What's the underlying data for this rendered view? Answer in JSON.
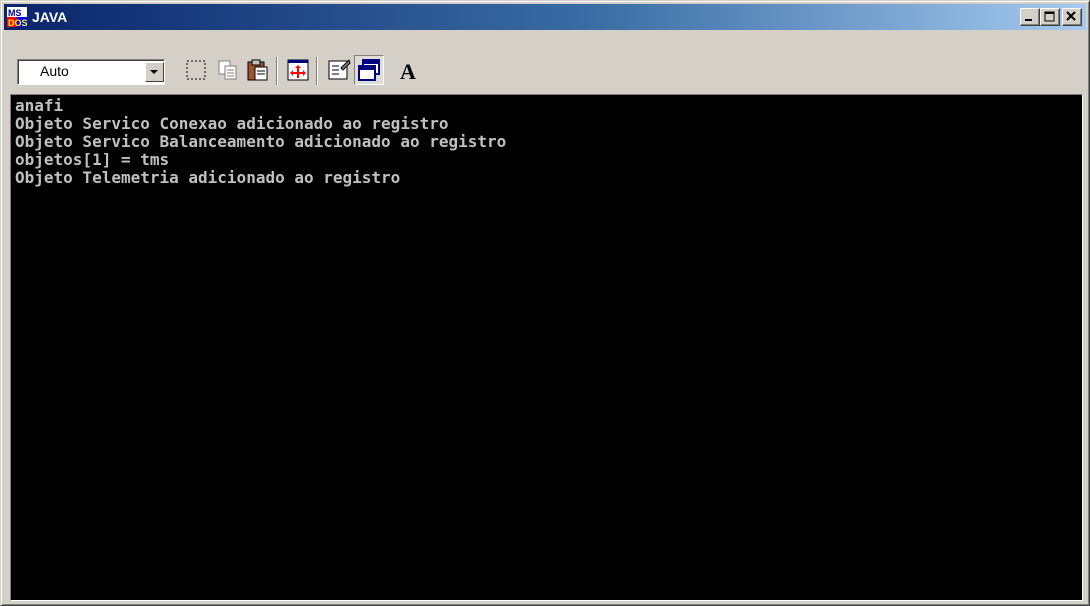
{
  "window": {
    "title": "JAVA",
    "icon": "ms-dos-icon"
  },
  "titlebar_buttons": {
    "minimize": "minimize-icon",
    "maximize": "maximize-icon",
    "close": "close-icon"
  },
  "toolbar": {
    "font_size_value": "Auto",
    "buttons": [
      {
        "name": "mark-icon"
      },
      {
        "name": "copy-icon"
      },
      {
        "name": "paste-icon"
      },
      {
        "name": "fullscreen-icon"
      },
      {
        "name": "properties-icon"
      },
      {
        "name": "background-icon",
        "pressed": true
      },
      {
        "name": "font-icon",
        "label": "A"
      }
    ]
  },
  "console": {
    "lines": [
      "anafi",
      "Objeto Servico Conexao adicionado ao registro",
      "Objeto Servico Balanceamento adicionado ao registro",
      "objetos[1] = tms",
      "Objeto Telemetria adicionado ao registro"
    ],
    "foreground": "#c0c0c0",
    "background": "#000000"
  },
  "colors": {
    "titlebar_start": "#0a246a",
    "titlebar_end": "#a6caf0",
    "chrome": "#d4d0c8"
  }
}
